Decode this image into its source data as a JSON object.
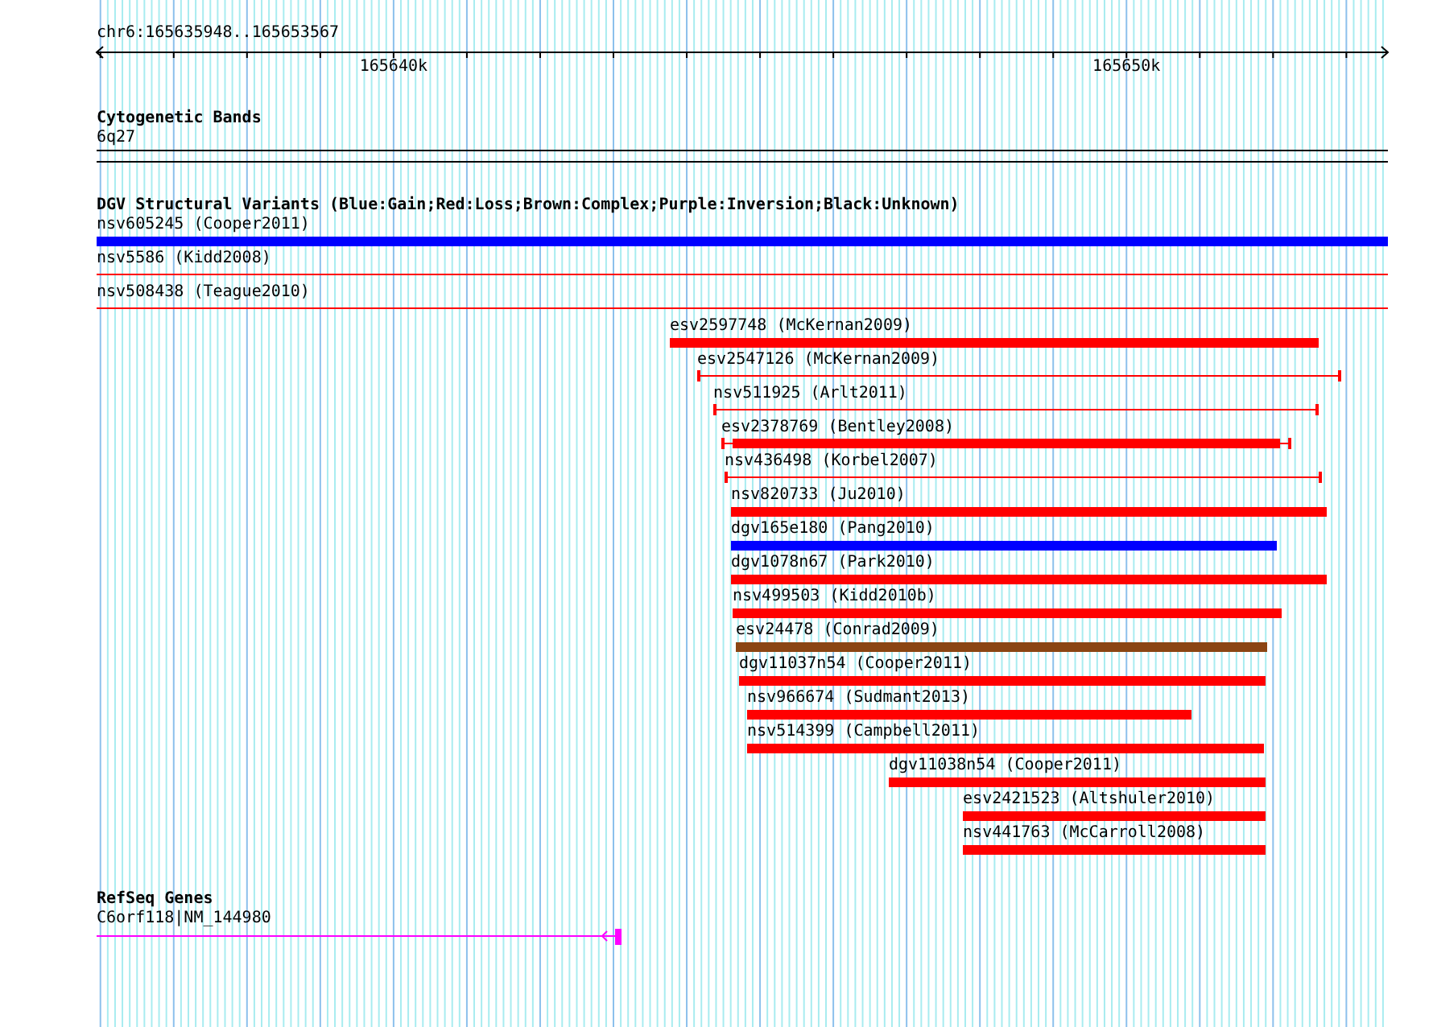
{
  "location": "chr6:165635948..165653567",
  "ruler": {
    "ticks": [
      "165640k",
      "165650k"
    ]
  },
  "tracks": [
    {
      "kind": "cytoband",
      "title": "Cytogenetic Bands",
      "label": "6q27"
    },
    {
      "kind": "variants",
      "title": "DGV Structural Variants (Blue:Gain;Red:Loss;Brown:Complex;Purple:Inversion;Black:Unknown)",
      "features": [
        {
          "name": "nsv605245 (Cooper2011)",
          "kind": "thick",
          "color": "#0000ff"
        },
        {
          "name": "nsv5586 (Kidd2008)",
          "kind": "line",
          "color": "#ff0000"
        },
        {
          "name": "nsv508438 (Teague2010)",
          "kind": "line",
          "color": "#ff0000"
        },
        {
          "name": "esv2597748 (McKernan2009)",
          "kind": "thick",
          "color": "#ff0000"
        },
        {
          "name": "esv2547126 (McKernan2009)",
          "kind": "capped",
          "color": "#ff0000"
        },
        {
          "name": "nsv511925 (Arlt2011)",
          "kind": "capped",
          "color": "#ff0000"
        },
        {
          "name": "esv2378769 (Bentley2008)",
          "kind": "mixed",
          "color": "#ff0000"
        },
        {
          "name": "nsv436498 (Korbel2007)",
          "kind": "capped",
          "color": "#ff0000"
        },
        {
          "name": "nsv820733 (Ju2010)",
          "kind": "thick",
          "color": "#ff0000"
        },
        {
          "name": "dgv165e180 (Pang2010)",
          "kind": "thick",
          "color": "#0000ff"
        },
        {
          "name": "dgv1078n67 (Park2010)",
          "kind": "thick",
          "color": "#ff0000"
        },
        {
          "name": "nsv499503 (Kidd2010b)",
          "kind": "thick",
          "color": "#ff0000"
        },
        {
          "name": "esv24478 (Conrad2009)",
          "kind": "thick",
          "color": "#8b4513"
        },
        {
          "name": "dgv11037n54 (Cooper2011)",
          "kind": "thick",
          "color": "#ff0000"
        },
        {
          "name": "nsv966674 (Sudmant2013)",
          "kind": "thick",
          "color": "#ff0000"
        },
        {
          "name": "nsv514399 (Campbell2011)",
          "kind": "thick",
          "color": "#ff0000"
        },
        {
          "name": "dgv11038n54 (Cooper2011)",
          "kind": "thick",
          "color": "#ff0000"
        },
        {
          "name": "esv2421523 (Altshuler2010)",
          "kind": "thick",
          "color": "#ff0000"
        },
        {
          "name": "nsv441763 (McCarroll2008)",
          "kind": "thick",
          "color": "#ff0000"
        }
      ]
    },
    {
      "kind": "genes",
      "title": "RefSeq Genes",
      "features": [
        {
          "name": "C6orf118|NM_144980",
          "kind": "gene",
          "color": "#ff00ff",
          "reverse_strand": true
        }
      ]
    }
  ]
}
